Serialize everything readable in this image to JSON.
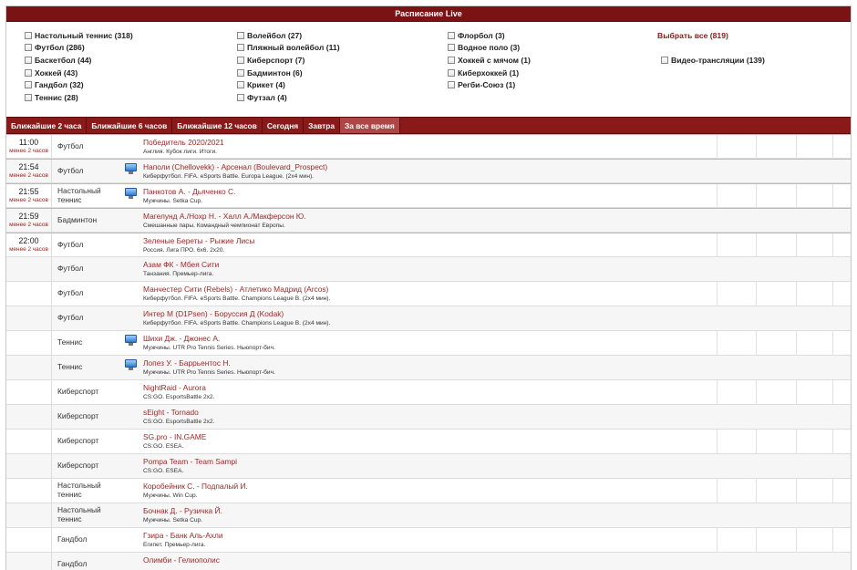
{
  "header": {
    "title": "Расписание Live"
  },
  "filters": {
    "col1": [
      "Настольный теннис (318)",
      "Футбол (286)",
      "Баскетбол (44)",
      "Хоккей (43)",
      "Гандбол (32)",
      "Теннис (28)"
    ],
    "col2": [
      "Волейбол (27)",
      "Пляжный волейбол (11)",
      "Киберспорт (7)",
      "Бадминтон (6)",
      "Крикет (4)",
      "Футзал (4)"
    ],
    "col3": [
      "Флорбол (3)",
      "Водное поло (3)",
      "Хоккей с мячом (1)",
      "Киберхоккей (1)",
      "Регби-Союз (1)"
    ],
    "select_all": "Выбрать все (819)",
    "video": "Видео-трансляции (139)"
  },
  "tabs": [
    "Ближайшие 2 часа",
    "Ближайшие 6 часов",
    "Ближайшие 12 часов",
    "Сегодня",
    "Завтра",
    "За все время"
  ],
  "active_tab": 5,
  "rows": [
    {
      "time": "11:00",
      "sub": "менее 2 часов",
      "sport": "Футбол",
      "video": false,
      "event": "Победитель 2020/2021",
      "league": "Англия. Кубок лиги. Итоги."
    },
    {
      "time": "21:54",
      "sub": "менее 2 часов",
      "sport": "Футбол",
      "video": true,
      "event": "Наполи (Chellovekk) - Арсенал (Boulevard_Prospect)",
      "league": "Киберфутбол. FIFA. eSports Battle. Europa League. (2x4 мин)."
    },
    {
      "time": "21:55",
      "sub": "менее 2 часов",
      "sport": "Настольный теннис",
      "video": true,
      "event": "Панкотов А. - Дьяченко С.",
      "league": "Мужчины. Setka Cup."
    },
    {
      "time": "21:59",
      "sub": "менее 2 часов",
      "sport": "Бадминтон",
      "video": false,
      "event": "Магелунд А./Нохр Н. - Халл А./Макферсон Ю.",
      "league": "Смешанные пары. Командный чемпионат Европы."
    },
    {
      "time": "22:00",
      "sub": "менее 2 часов",
      "sport": "Футбол",
      "video": false,
      "event": "Зеленые Береты - Рыжие Лисы",
      "league": "Россия. Лига ПРО. 6х6. 2х20."
    },
    {
      "time": "",
      "sub": "",
      "sport": "Футбол",
      "video": false,
      "event": "Азам ФК - Мбея Сити",
      "league": "Танзания. Премьер-лига."
    },
    {
      "time": "",
      "sub": "",
      "sport": "Футбол",
      "video": false,
      "event": "Манчестер Сити (Rebels) - Атлетико Мадрид (Arcos)",
      "league": "Киберфутбол. FIFA. eSports Battle. Champions League B. (2x4 мин)."
    },
    {
      "time": "",
      "sub": "",
      "sport": "Футбол",
      "video": false,
      "event": "Интер М (D1Psen) - Боруссия Д (Kodak)",
      "league": "Киберфутбол. FIFA. eSports Battle. Champions League B. (2x4 мин)."
    },
    {
      "time": "",
      "sub": "",
      "sport": "Теннис",
      "video": true,
      "event": "Шихи Дж. - Джонес А.",
      "league": "Мужчины. UTR Pro Tennis Series. Ньюпорт-бич."
    },
    {
      "time": "",
      "sub": "",
      "sport": "Теннис",
      "video": true,
      "event": "Лопез У. - Баррьентос Н.",
      "league": "Мужчины. UTR Pro Tennis Series. Ньюпорт-бич."
    },
    {
      "time": "",
      "sub": "",
      "sport": "Киберспорт",
      "video": false,
      "event": "NightRaid - Aurora",
      "league": "CS:GO. EsportsBattle 2x2."
    },
    {
      "time": "",
      "sub": "",
      "sport": "Киберспорт",
      "video": false,
      "event": "sEight - Tornado",
      "league": "CS:GO. EsportsBattle 2x2."
    },
    {
      "time": "",
      "sub": "",
      "sport": "Киберспорт",
      "video": false,
      "event": "SG.pro - IN.GAME",
      "league": "CS:GO. ESEA."
    },
    {
      "time": "",
      "sub": "",
      "sport": "Киберспорт",
      "video": false,
      "event": "Pompa Team - Team Sampi",
      "league": "CS:GO. ESEA."
    },
    {
      "time": "",
      "sub": "",
      "sport": "Настольный теннис",
      "video": false,
      "event": "Коробейник С. - Подпалый И.",
      "league": "Мужчины. Win Cup."
    },
    {
      "time": "",
      "sub": "",
      "sport": "Настольный теннис",
      "video": false,
      "event": "Бочнак Д. - Рузичка Й.",
      "league": "Мужчины. Setka Cup."
    },
    {
      "time": "",
      "sub": "",
      "sport": "Гандбол",
      "video": false,
      "event": "Гзира - Банк Аль-Ахли",
      "league": "Египет. Премьер-лига."
    },
    {
      "time": "",
      "sub": "",
      "sport": "Гандбол",
      "video": false,
      "event": "Олимби - Гелиополис",
      "league": ""
    }
  ],
  "colors": {
    "header": "#7a1313",
    "tab_bar": "#8a1a1a",
    "tab_active": "#b04545",
    "event_link": "#a02828",
    "sub_time": "#a02020"
  },
  "icons": {
    "video": "monitor-icon"
  }
}
